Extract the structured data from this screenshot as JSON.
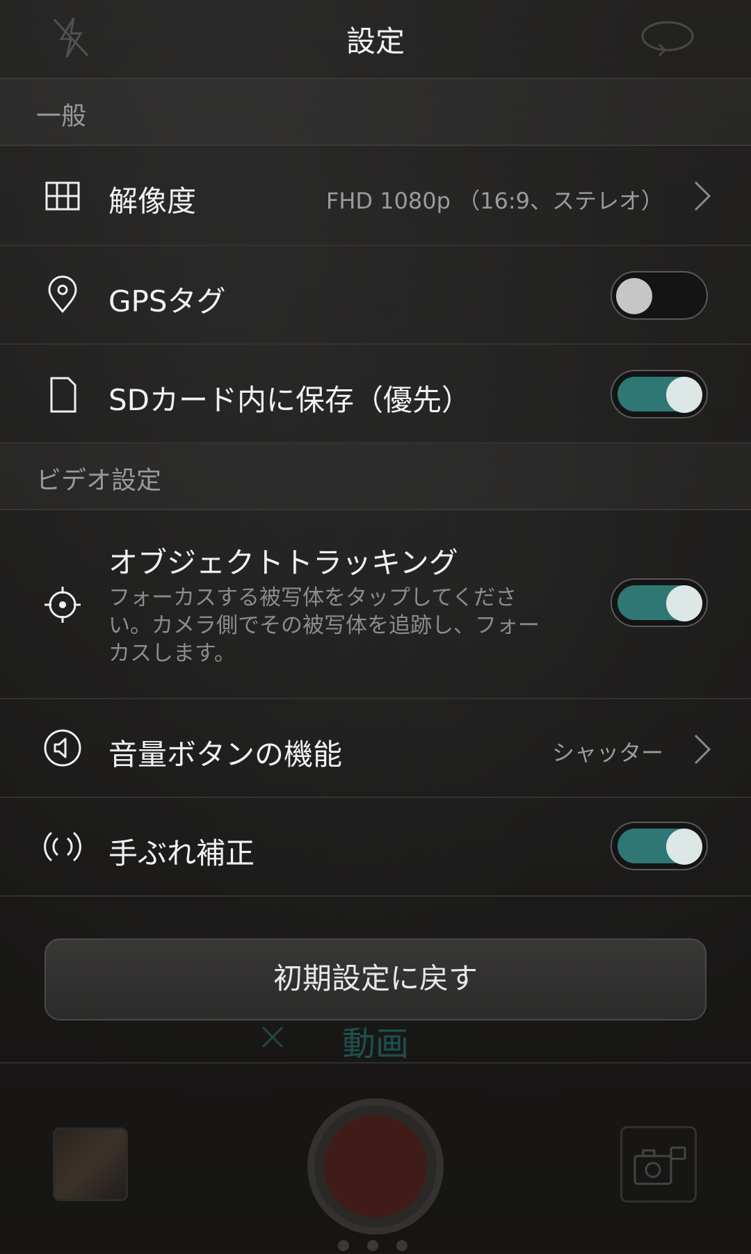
{
  "header": {
    "title": "設定",
    "left_icon": "flash-off-icon",
    "right_icon": "switch-camera-icon"
  },
  "sections": {
    "general": "一般",
    "video": "ビデオ設定"
  },
  "rows": {
    "resolution": {
      "label": "解像度",
      "value": "FHD 1080p （16:9、ステレオ）",
      "icon": "grid-icon"
    },
    "gps": {
      "label": "GPSタグ",
      "enabled": false,
      "icon": "location-pin-icon"
    },
    "sd_card": {
      "label": "SDカード内に保存（優先）",
      "enabled": true,
      "icon": "sd-card-icon"
    },
    "tracking": {
      "label": "オブジェクトトラッキング",
      "description_line1": "フォーカスする被写体をタップしてくださ",
      "description_line2": "い。カメラ側でその被写体を追跡し、フォー",
      "description_line3": "カスします。",
      "enabled": true,
      "icon": "crosshair-icon"
    },
    "volume_button": {
      "label": "音量ボタンの機能",
      "value": "シャッター",
      "icon": "volume-icon"
    },
    "stabilization": {
      "label": "手ぶれ補正",
      "enabled": true,
      "icon": "stabilization-icon"
    }
  },
  "reset_button": "初期設定に戻す",
  "background_camera": {
    "mode_label": "動画"
  },
  "colors": {
    "toggle_on": "#2e7774",
    "toggle_knob_on": "#dde7e6",
    "toggle_knob_off": "#c6c6c6",
    "background": "#1a1918"
  }
}
